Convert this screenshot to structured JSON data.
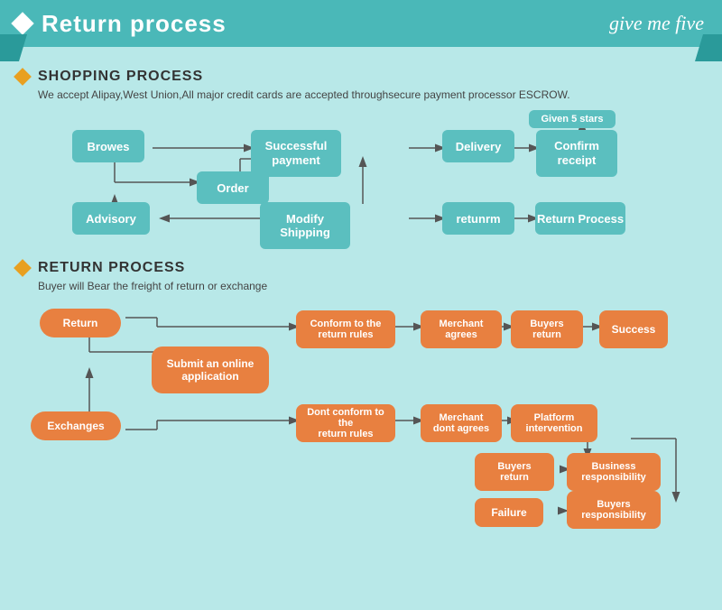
{
  "header": {
    "title": "Return process",
    "logo": "give me five"
  },
  "shopping": {
    "section_title": "SHOPPING PROCESS",
    "subtitle": "We accept Alipay,West Union,All major credit cards are accepted throughsecure payment processor ESCROW.",
    "nodes": {
      "browes": "Browes",
      "order": "Order",
      "advisory": "Advisory",
      "successful_payment": "Successful\npayment",
      "delivery": "Delivery",
      "confirm_receipt": "Confirm\nreceipt",
      "given_5_stars": "Given 5 stars",
      "modify_shipping": "Modify\nShipping",
      "retunrm": "retunrm",
      "return_process": "Return Process"
    }
  },
  "return": {
    "section_title": "RETURN PROCESS",
    "subtitle": "Buyer will Bear the freight of return or exchange",
    "nodes": {
      "return": "Return",
      "exchanges": "Exchanges",
      "submit_online": "Submit an online\napplication",
      "conform_rules": "Conform to the\nreturn rules",
      "dont_conform_rules": "Dont conform to the\nreturn rules",
      "merchant_agrees": "Merchant\nagrees",
      "merchant_dont_agrees": "Merchant\ndont agrees",
      "buyers_return_1": "Buyers\nreturn",
      "buyers_return_2": "Buyers\nreturn",
      "platform_intervention": "Platform\nintervention",
      "success": "Success",
      "business_responsibility": "Business\nresponsibility",
      "buyers_responsibility": "Buyers\nresponsibility",
      "failure": "Failure"
    }
  }
}
